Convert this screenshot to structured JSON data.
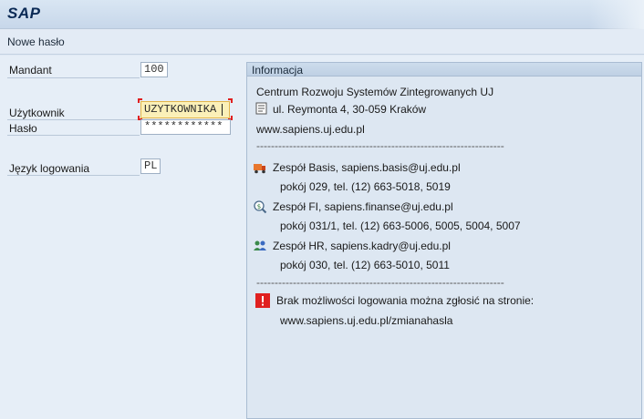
{
  "window": {
    "app_name": "SAP",
    "screen_title": "Nowe hasło"
  },
  "form": {
    "client_label": "Mandant",
    "client_value": "100",
    "user_label": "Użytkownik",
    "user_value": "UZYTKOWNIKA",
    "password_label": "Hasło",
    "password_value": "************",
    "language_label": "Język logowania",
    "language_value": "PL"
  },
  "info": {
    "title": "Informacja",
    "org_name": "Centrum Rozwoju Systemów Zintegrowanych UJ",
    "address": "ul. Reymonta 4, 30-059 Kraków",
    "website": "www.sapiens.uj.edu.pl",
    "separator": "--------------------------------------------------------------------",
    "teams": [
      {
        "name": "Zespół Basis, sapiens.basis@uj.edu.pl",
        "details": "pokój 029, tel. (12) 663-5018, 5019",
        "icon": "truck-icon"
      },
      {
        "name": "Zespół FI, sapiens.finanse@uj.edu.pl",
        "details": "pokój 031/1, tel. (12) 663-5006, 5005, 5004, 5007",
        "icon": "money-search-icon"
      },
      {
        "name": "Zespół HR, sapiens.kadry@uj.edu.pl",
        "details": "pokój 030, tel. (12) 663-5010, 5011",
        "icon": "people-icon"
      }
    ],
    "notice": "Brak możliwości logowania można zgłosić na stronie:",
    "notice_url": "www.sapiens.uj.edu.pl/zmianahasla"
  },
  "colors": {
    "accent": "#0b2a55",
    "active_field": "#fbf0b8",
    "error": "#e02020"
  }
}
